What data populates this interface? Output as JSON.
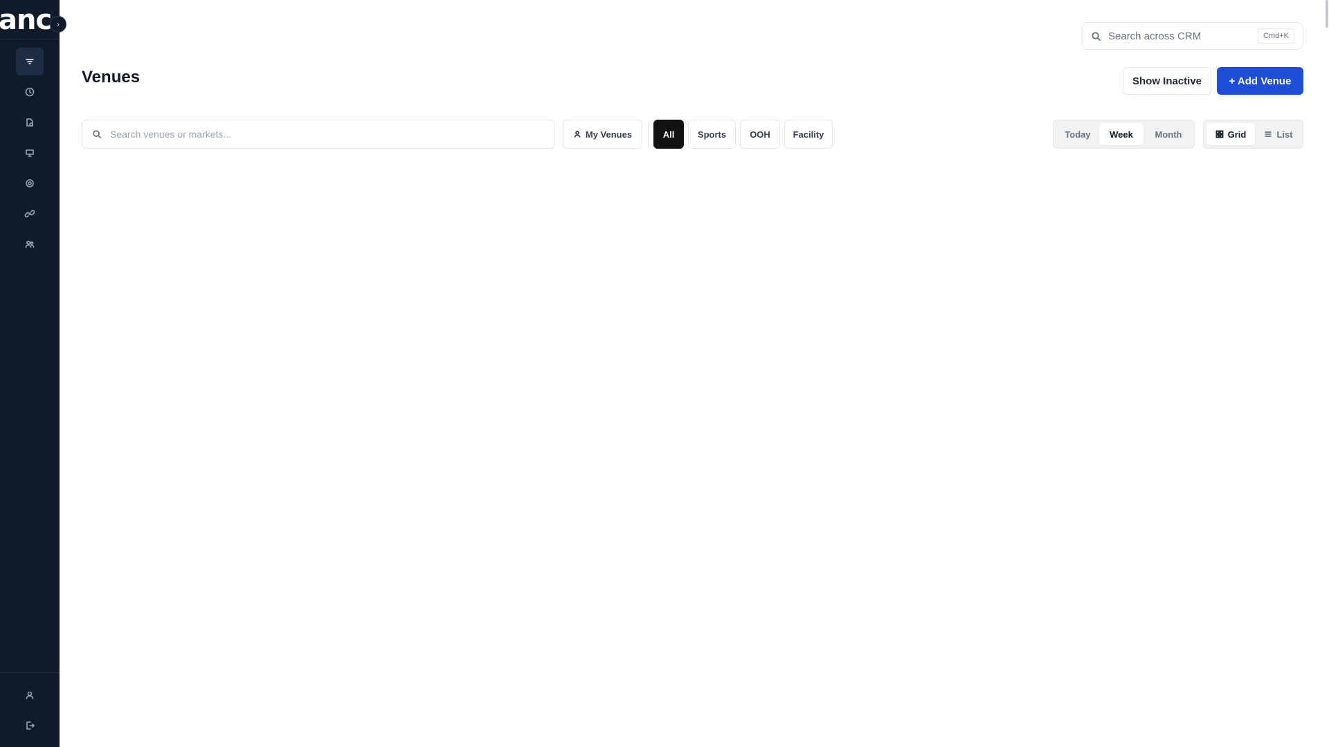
{
  "sidebar": {
    "logo_text": "anc",
    "collapse_glyph": "›",
    "nav_items": [
      {
        "icon": "filter-icon",
        "active": true
      },
      {
        "icon": "clock-icon",
        "active": false
      },
      {
        "icon": "documents-icon",
        "active": false
      },
      {
        "icon": "monitor-icon",
        "active": false
      },
      {
        "icon": "gear-icon",
        "active": false
      },
      {
        "icon": "link-icon",
        "active": false
      },
      {
        "icon": "users-icon",
        "active": false
      }
    ],
    "bottom_items": [
      {
        "icon": "user-icon"
      },
      {
        "icon": "logout-icon"
      }
    ]
  },
  "global_search": {
    "placeholder": "Search across CRM",
    "shortcut": "Cmd+K"
  },
  "page": {
    "title": "Venues"
  },
  "header_actions": {
    "show_inactive_label": "Show Inactive",
    "add_venue_label": "+ Add Venue"
  },
  "filters": {
    "search_placeholder": "Search venues or markets...",
    "my_venues_label": "My Venues",
    "categories": [
      "All",
      "Sports",
      "OOH",
      "Facility"
    ],
    "active_category": "All"
  },
  "time_range": {
    "options": [
      "Today",
      "Week",
      "Month"
    ],
    "selected": "Week"
  },
  "view_mode": {
    "options": [
      "Grid",
      "List"
    ],
    "selected": "Grid"
  },
  "colors": {
    "sidebar_bg": "#0f1b2a",
    "accent": "#1d4ed8",
    "active_chip": "#111111"
  }
}
